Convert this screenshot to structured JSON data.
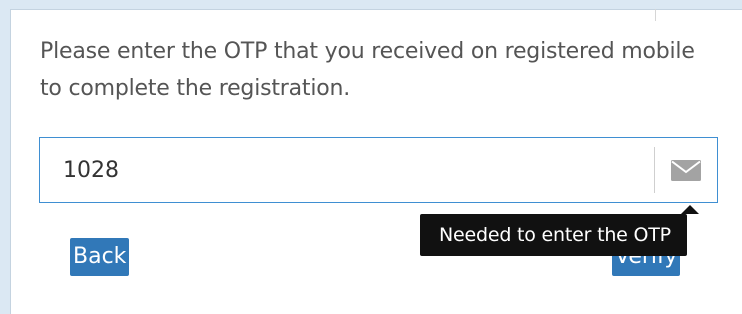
{
  "otp_form": {
    "message": "Please enter the OTP that you received on registered mobile to complete the registration.",
    "otp_value": "1028",
    "addon_icon": "envelope-icon",
    "tooltip_text": "Needed to enter the OTP",
    "back_label": "Back",
    "verify_label": "Verify"
  },
  "colors": {
    "input_border": "#3f8fd2",
    "button_bg": "#3178b8",
    "tooltip_bg": "#111111",
    "page_bg": "#dbe8f3"
  }
}
